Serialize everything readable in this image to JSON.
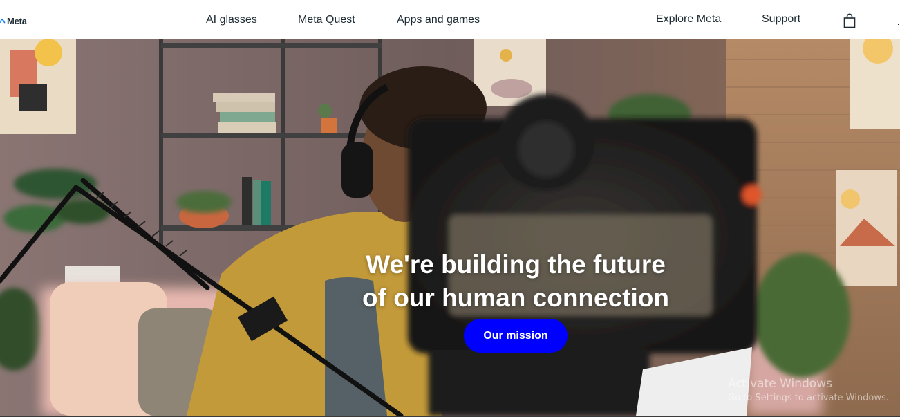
{
  "header": {
    "logo_text": "Meta",
    "nav_left": [
      {
        "label": "AI glasses"
      },
      {
        "label": "Meta Quest"
      },
      {
        "label": "Apps and games"
      }
    ],
    "nav_right": [
      {
        "label": "Explore Meta"
      },
      {
        "label": "Support"
      }
    ],
    "cart_icon": "shopping-bag-icon"
  },
  "hero": {
    "title_line1": "We're building the future",
    "title_line2": "of our human connection",
    "cta_label": "Our mission"
  },
  "os_watermark": {
    "title": "Activate Windows",
    "subtitle": "Go to Settings to activate Windows."
  },
  "colors": {
    "cta_background": "#0000ff",
    "nav_text": "#1c2b33",
    "hero_text": "#ffffff"
  }
}
